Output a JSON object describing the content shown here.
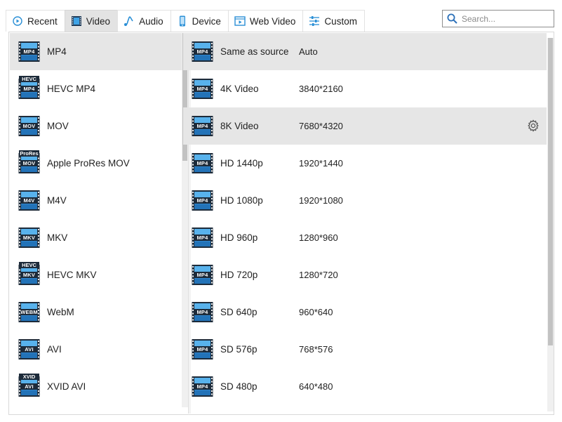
{
  "tabs": [
    {
      "label": "Recent",
      "icon": "recent-icon",
      "active": false
    },
    {
      "label": "Video",
      "icon": "video-film-icon",
      "active": true
    },
    {
      "label": "Audio",
      "icon": "audio-note-icon",
      "active": false
    },
    {
      "label": "Device",
      "icon": "phone-icon",
      "active": false
    },
    {
      "label": "Web Video",
      "icon": "web-video-icon",
      "active": false
    },
    {
      "label": "Custom",
      "icon": "sliders-icon",
      "active": false
    }
  ],
  "search": {
    "placeholder": "Search..."
  },
  "formats": [
    {
      "label": "MP4",
      "badge": "MP4",
      "top": "",
      "selected": true
    },
    {
      "label": "HEVC MP4",
      "badge": "MP4",
      "top": "HEVC",
      "selected": false
    },
    {
      "label": "MOV",
      "badge": "MOV",
      "top": "",
      "selected": false
    },
    {
      "label": "Apple ProRes MOV",
      "badge": "MOV",
      "top": "ProRes",
      "selected": false
    },
    {
      "label": "M4V",
      "badge": "M4V",
      "top": "",
      "selected": false
    },
    {
      "label": "MKV",
      "badge": "MKV",
      "top": "",
      "selected": false
    },
    {
      "label": "HEVC MKV",
      "badge": "MKV",
      "top": "HEVC",
      "selected": false
    },
    {
      "label": "WebM",
      "badge": "WEBM",
      "top": "",
      "selected": false
    },
    {
      "label": "AVI",
      "badge": "AVI",
      "top": "",
      "selected": false
    },
    {
      "label": "XVID AVI",
      "badge": "AVI",
      "top": "XVID",
      "selected": false
    }
  ],
  "presets": [
    {
      "name": "Same as source",
      "resolution": "Auto",
      "badge": "MP4",
      "selected": true,
      "gear": false
    },
    {
      "name": "4K Video",
      "resolution": "3840*2160",
      "badge": "MP4",
      "selected": false,
      "gear": false
    },
    {
      "name": "8K Video",
      "resolution": "7680*4320",
      "badge": "MP4",
      "selected": true,
      "gear": true
    },
    {
      "name": "HD 1440p",
      "resolution": "1920*1440",
      "badge": "MP4",
      "selected": false,
      "gear": false
    },
    {
      "name": "HD 1080p",
      "resolution": "1920*1080",
      "badge": "MP4",
      "selected": false,
      "gear": false
    },
    {
      "name": "HD 960p",
      "resolution": "1280*960",
      "badge": "MP4",
      "selected": false,
      "gear": false
    },
    {
      "name": "HD 720p",
      "resolution": "1280*720",
      "badge": "MP4",
      "selected": false,
      "gear": false
    },
    {
      "name": "SD 640p",
      "resolution": "960*640",
      "badge": "MP4",
      "selected": false,
      "gear": false
    },
    {
      "name": "SD 576p",
      "resolution": "768*576",
      "badge": "MP4",
      "selected": false,
      "gear": false
    },
    {
      "name": "SD 480p",
      "resolution": "640*480",
      "badge": "MP4",
      "selected": false,
      "gear": false
    }
  ],
  "colors": {
    "accent": "#1e88e5",
    "selected_row": "#e6e6e6",
    "active_tab": "#e3e3e3"
  }
}
